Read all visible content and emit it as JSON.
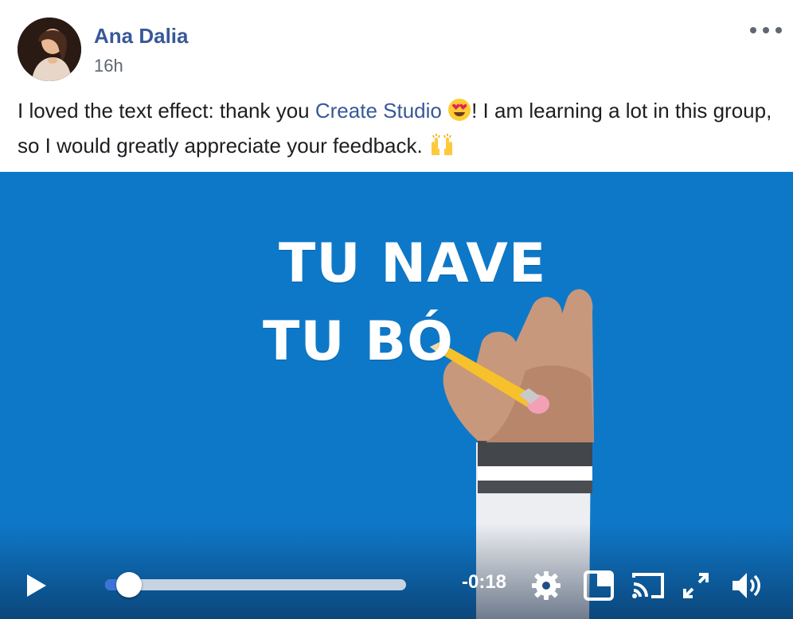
{
  "post": {
    "author": "Ana Dalia",
    "timestamp": "16h",
    "text_part1": "I loved the text effect: thank you ",
    "mention": "Create Studio",
    "text_part2": "! I am learning a lot in this group, so I would greatly appreciate your feedback. ",
    "emoji_1": "heart-eyes-emoji",
    "emoji_2": "raising-hands-emoji"
  },
  "video": {
    "overlay_line1": "TU NAVE",
    "overlay_line2": "TU BÓ",
    "background_color": "#0e78c8",
    "progress_fraction": 0.08,
    "time_remaining": "-0:18",
    "controls": [
      "play-icon",
      "gear-icon",
      "miniplayer-icon",
      "cast-icon",
      "fullscreen-icon",
      "volume-icon"
    ]
  },
  "colors": {
    "link": "#385898",
    "progress_fill": "#3b74d6"
  }
}
